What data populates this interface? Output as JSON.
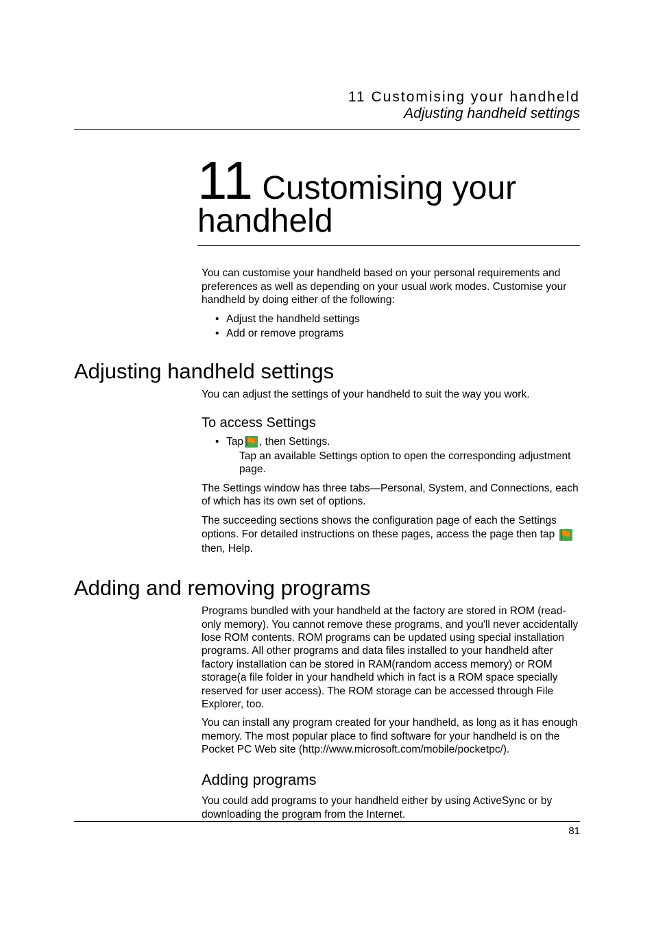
{
  "header": {
    "section_line": "11 Customising your handheld",
    "subsection_line": "Adjusting handheld settings"
  },
  "chapter": {
    "number": "11",
    "title_part1": " Customising your",
    "title_part2": "handheld"
  },
  "intro": {
    "p1": "You can customise your handheld based on your personal requirements and preferences as well as depending on your usual work modes. Customise your handheld by doing either of the following:",
    "bullets": [
      "Adjust the handheld settings",
      "Add or remove programs"
    ]
  },
  "section1": {
    "heading": "Adjusting handheld settings",
    "p1": "You can adjust the settings of your handheld to suit the way you work.",
    "sub1_heading": "To access Settings",
    "bullet_pre": "Tap ",
    "bullet_post": " , then Settings.",
    "bullet_sub": "Tap an available Settings option to open the corresponding adjustment page.",
    "p2": "The Settings window has three tabs—Personal, System, and Connections, each of which has its own set of options.",
    "p3_pre": "The succeeding sections shows the configuration page of each the Settings options. For detailed instructions on these pages, access the page then tap ",
    "p3_post": " then, Help."
  },
  "section2": {
    "heading": "Adding and removing programs",
    "p1": "Programs bundled with your handheld at the factory are stored in ROM (read-only memory). You cannot remove these programs, and you'll never accidentally lose ROM contents. ROM programs can be updated using special installation programs. All other programs and data files installed to your handheld after factory installation can be stored in RAM(random access memory) or ROM storage(a file folder in your handheld which in fact is a ROM space specially reserved for user access). The ROM storage can be accessed through File Explorer, too.",
    "p2": "You can install any program created for your handheld, as long as it has enough memory. The most popular place to find software for your handheld is on the Pocket PC Web site (http://www.microsoft.com/mobile/pocketpc/).",
    "sub1_heading": "Adding programs",
    "p3": "You could add programs to your handheld either by using ActiveSync or by downloading the program from the Internet."
  },
  "page_number": "81"
}
